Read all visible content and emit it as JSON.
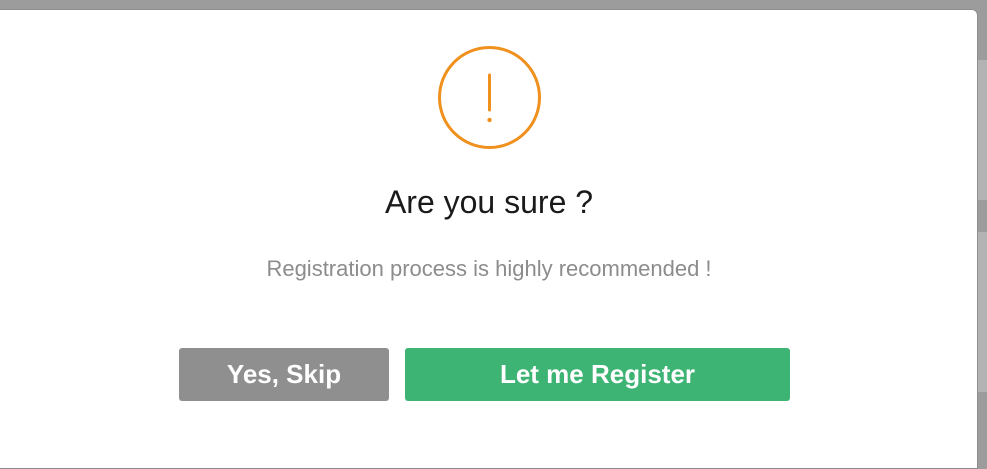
{
  "dialog": {
    "icon": "warning-exclamation-icon",
    "title": "Are you sure ?",
    "message": "Registration process is highly recommended !",
    "buttons": {
      "skip_label": "Yes, Skip",
      "register_label": "Let me Register"
    }
  },
  "colors": {
    "warning": "#f0901d",
    "skip_button": "#8f8f8f",
    "register_button": "#3db374",
    "title_text": "#1a1a1a",
    "message_text": "#8c8c8c"
  }
}
